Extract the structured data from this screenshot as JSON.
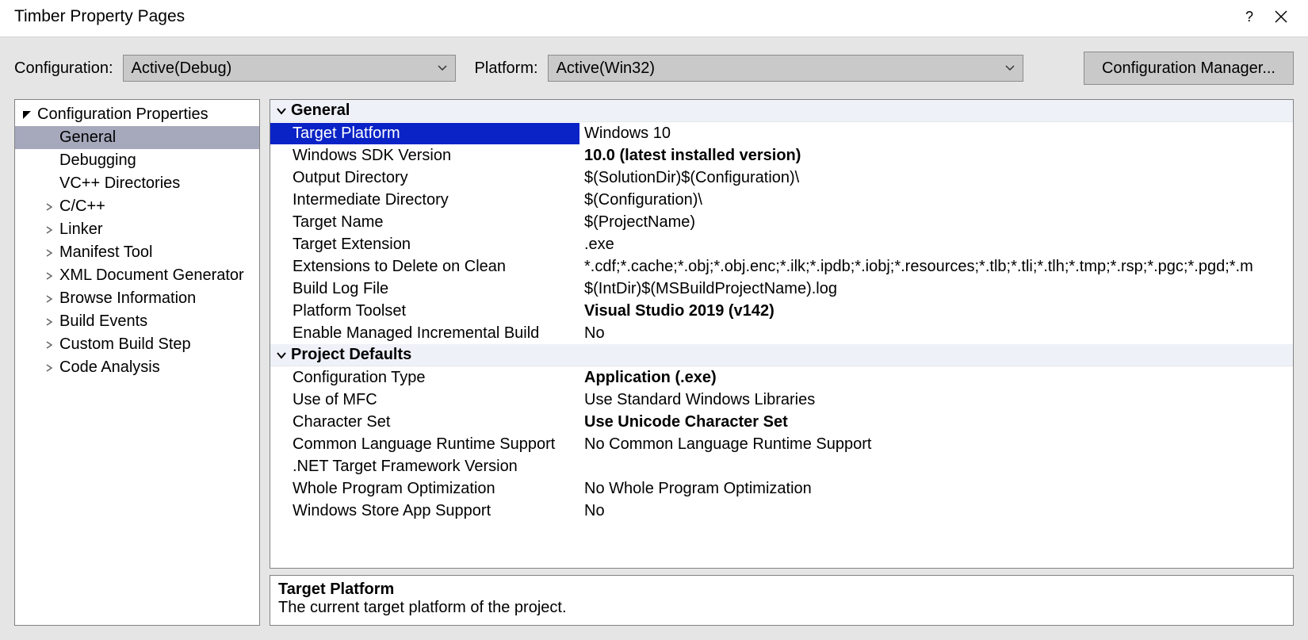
{
  "window": {
    "title": "Timber Property Pages"
  },
  "toolbar": {
    "config_label": "Configuration:",
    "config_value": "Active(Debug)",
    "platform_label": "Platform:",
    "platform_value": "Active(Win32)",
    "config_mgr_label": "Configuration Manager..."
  },
  "tree": {
    "root": "Configuration Properties",
    "items": [
      {
        "label": "General",
        "selected": true,
        "expandable": false
      },
      {
        "label": "Debugging",
        "selected": false,
        "expandable": false
      },
      {
        "label": "VC++ Directories",
        "selected": false,
        "expandable": false
      },
      {
        "label": "C/C++",
        "selected": false,
        "expandable": true
      },
      {
        "label": "Linker",
        "selected": false,
        "expandable": true
      },
      {
        "label": "Manifest Tool",
        "selected": false,
        "expandable": true
      },
      {
        "label": "XML Document Generator",
        "selected": false,
        "expandable": true
      },
      {
        "label": "Browse Information",
        "selected": false,
        "expandable": true
      },
      {
        "label": "Build Events",
        "selected": false,
        "expandable": true
      },
      {
        "label": "Custom Build Step",
        "selected": false,
        "expandable": true
      },
      {
        "label": "Code Analysis",
        "selected": false,
        "expandable": true
      }
    ]
  },
  "grid": {
    "cat1": "General",
    "cat2": "Project Defaults",
    "rows1": [
      {
        "label": "Target Platform",
        "value": "Windows 10",
        "bold": false,
        "sel": true
      },
      {
        "label": "Windows SDK Version",
        "value": "10.0 (latest installed version)",
        "bold": true
      },
      {
        "label": "Output Directory",
        "value": "$(SolutionDir)$(Configuration)\\"
      },
      {
        "label": "Intermediate Directory",
        "value": "$(Configuration)\\"
      },
      {
        "label": "Target Name",
        "value": "$(ProjectName)"
      },
      {
        "label": "Target Extension",
        "value": ".exe"
      },
      {
        "label": "Extensions to Delete on Clean",
        "value": "*.cdf;*.cache;*.obj;*.obj.enc;*.ilk;*.ipdb;*.iobj;*.resources;*.tlb;*.tli;*.tlh;*.tmp;*.rsp;*.pgc;*.pgd;*.m"
      },
      {
        "label": "Build Log File",
        "value": "$(IntDir)$(MSBuildProjectName).log"
      },
      {
        "label": "Platform Toolset",
        "value": "Visual Studio 2019 (v142)",
        "bold": true
      },
      {
        "label": "Enable Managed Incremental Build",
        "value": "No"
      }
    ],
    "rows2": [
      {
        "label": "Configuration Type",
        "value": "Application (.exe)",
        "bold": true
      },
      {
        "label": "Use of MFC",
        "value": "Use Standard Windows Libraries"
      },
      {
        "label": "Character Set",
        "value": "Use Unicode Character Set",
        "bold": true
      },
      {
        "label": "Common Language Runtime Support",
        "value": "No Common Language Runtime Support"
      },
      {
        "label": ".NET Target Framework Version",
        "value": ""
      },
      {
        "label": "Whole Program Optimization",
        "value": "No Whole Program Optimization"
      },
      {
        "label": "Windows Store App Support",
        "value": "No"
      }
    ]
  },
  "description": {
    "title": "Target Platform",
    "text": "The current target platform of the project."
  }
}
